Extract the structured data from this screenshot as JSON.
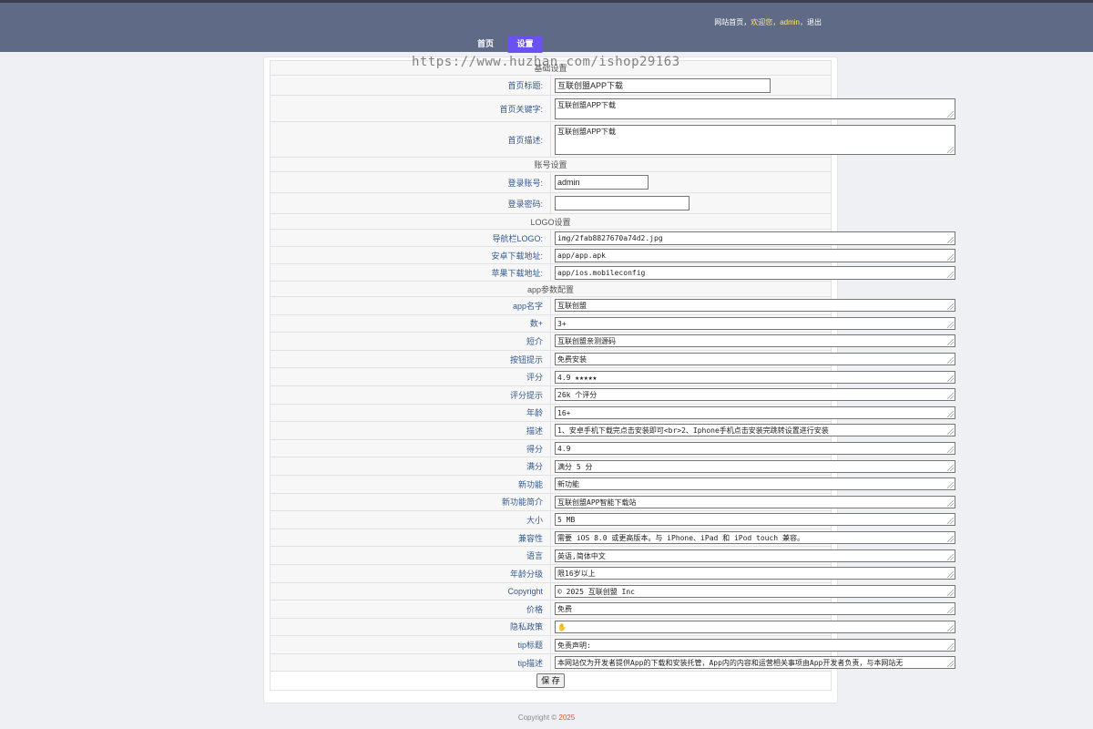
{
  "header": {
    "site_home": "网站首页",
    "welcome": "欢迎您，admin，",
    "logout": "退出",
    "nav": {
      "home": "首页",
      "settings": "设置"
    }
  },
  "watermark": "https://www.huzhan.com/ishop29163",
  "sections": {
    "basic": "基础设置",
    "account": "账号设置",
    "logo": "LOGO设置",
    "app": "app参数配置"
  },
  "basic": {
    "title_label": "首页标题:",
    "title_value": "互联创盟APP下载",
    "keywords_label": "首页关键字:",
    "keywords_value": "互联创盟APP下载",
    "desc_label": "首页描述:",
    "desc_value": "互联创盟APP下载"
  },
  "account": {
    "username_label": "登录账号:",
    "username_value": "admin",
    "password_label": "登录密码:",
    "password_value": ""
  },
  "logo": {
    "nav_logo_label": "导航栏LOGO:",
    "nav_logo_value": "img/2fab8827670a74d2.jpg",
    "android_label": "安卓下载地址:",
    "android_value": "app/app.apk",
    "ios_label": "苹果下载地址:",
    "ios_value": "app/ios.mobileconfig"
  },
  "app_params": [
    {
      "label": "app名字",
      "value": "互联创盟"
    },
    {
      "label": "数+",
      "value": "3+"
    },
    {
      "label": "短介",
      "value": "互联创盟亲测源码"
    },
    {
      "label": "按钮提示",
      "value": "免费安装"
    },
    {
      "label": "评分",
      "value": "4.9 ★★★★★"
    },
    {
      "label": "评分提示",
      "value": "26k 个评分"
    },
    {
      "label": "年龄",
      "value": "16+"
    },
    {
      "label": "描述",
      "value": "1、安卓手机下载完点击安装即可<br>2、Iphone手机点击安装完跳转设置进行安装"
    },
    {
      "label": "得分",
      "value": "4.9"
    },
    {
      "label": "满分",
      "value": "满分 5 分"
    },
    {
      "label": "新功能",
      "value": "新功能"
    },
    {
      "label": "新功能简介",
      "value": "互联创盟APP智能下载站"
    },
    {
      "label": "大小",
      "value": "5 MB"
    },
    {
      "label": "兼容性",
      "value": "需要 iOS 8.0 或更高版本。与 iPhone、iPad 和 iPod touch 兼容。"
    },
    {
      "label": "语言",
      "value": "英语,简体中文"
    },
    {
      "label": "年龄分级",
      "value": "限16岁以上"
    },
    {
      "label": "Copyright",
      "value": "© 2025 互联创盟 Inc"
    },
    {
      "label": "价格",
      "value": "免费"
    },
    {
      "label": "隐私政策",
      "value": "✋"
    },
    {
      "label": "tip标题",
      "value": "免责声明:"
    },
    {
      "label": "tip描述",
      "value": "本网站仅为开发者提供App的下载和安装托管，App内的内容和运营相关事项由App开发者负责，与本网站无"
    }
  ],
  "save_label": "保 存",
  "footer": {
    "text": "Copyright © ",
    "year": "2025"
  }
}
